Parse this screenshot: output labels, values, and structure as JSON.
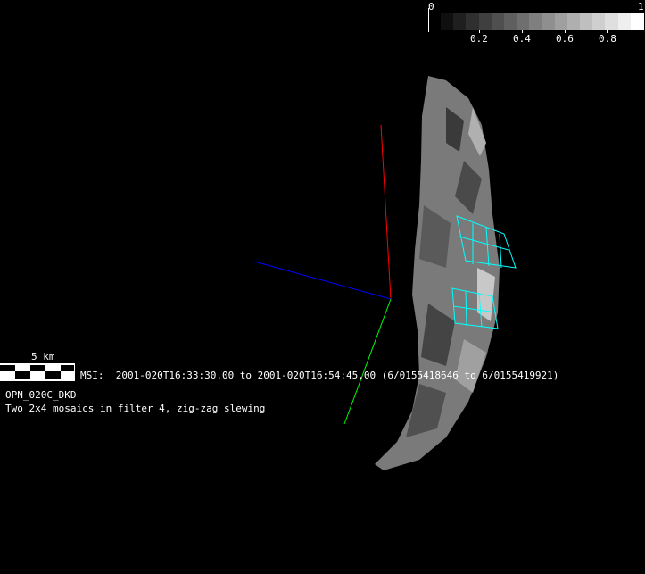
{
  "colorbar": {
    "min_label": "0",
    "max_label": "1",
    "ticks": [
      "0.2",
      "0.4",
      "0.6",
      "0.8"
    ],
    "steps": 16
  },
  "scale_bar": {
    "label": "5 km"
  },
  "info": {
    "instrument_line": "MSI:  2001-020T16:33:30.00 to 2001-020T16:54:45.00 (6/0155418646 to 6/0155419921)",
    "observation_id": "OPN_020C_DKD",
    "description": "Two 2x4 mosaics in filter 4, zig-zag slewing"
  },
  "colors": {
    "x_axis": "#ff0000",
    "y_axis": "#00ff00",
    "z_axis": "#0000ff",
    "footprint": "#00ffff"
  }
}
